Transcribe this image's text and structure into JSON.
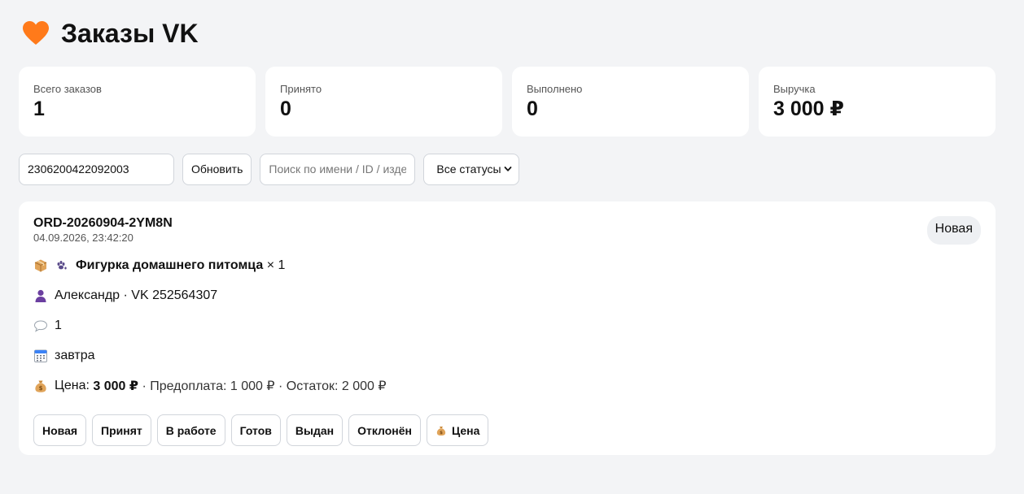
{
  "header": {
    "title": "Заказы VK",
    "icon": "orange-heart-icon",
    "accent": "#ff7a1a"
  },
  "stats": [
    {
      "label": "Всего заказов",
      "value": "1"
    },
    {
      "label": "Принято",
      "value": "0"
    },
    {
      "label": "Выполнено",
      "value": "0"
    },
    {
      "label": "Выручка",
      "value": "3 000 ₽"
    }
  ],
  "toolbar": {
    "id_value": "2306200422092003",
    "refresh_label": "Обновить",
    "search_placeholder": "Поиск по имени / ID / изделию",
    "status_selected": "Все статусы"
  },
  "order": {
    "id": "ORD-20260904-2YM8N",
    "date": "04.09.2026, 23:42:20",
    "status": "Новая",
    "product_name": "Фигурка домашнего питомца",
    "product_qty": "× 1",
    "customer": "Александр · VK 252564307",
    "comment": "1",
    "deadline": "завтра",
    "price_label": "Цена:",
    "price_value": "3 000 ₽",
    "price_rest": "· Предоплата: 1 000 ₽ · Остаток: 2 000 ₽"
  },
  "actions": {
    "new": "Новая",
    "accepted": "Принят",
    "in_work": "В работе",
    "ready": "Готов",
    "issued": "Выдан",
    "rejected": "Отклонён",
    "price": "Цена"
  }
}
